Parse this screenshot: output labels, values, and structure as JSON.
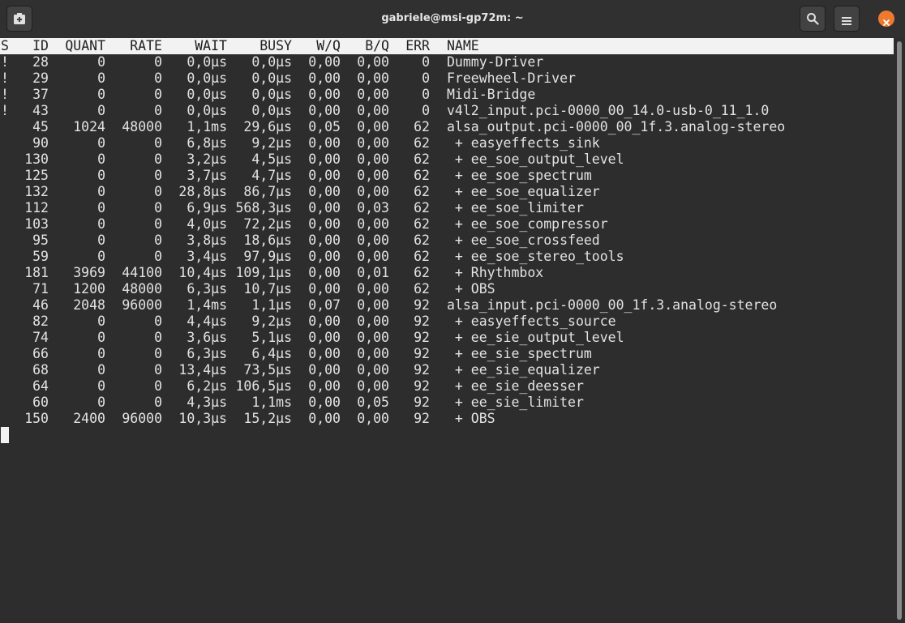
{
  "window": {
    "title": "gabriele@msi-gp72m: ~"
  },
  "icons": {
    "new_tab": "new-tab-icon",
    "search": "search-icon",
    "menu": "hamburger-menu-icon",
    "close": "close-icon"
  },
  "colors": {
    "close": "#ef7a2f",
    "background": "#2d2d2d",
    "header": "#f2f2f2"
  },
  "table": {
    "headers": [
      "S",
      "ID",
      "QUANT",
      "RATE",
      "WAIT",
      "BUSY",
      "W/Q",
      "B/Q",
      "ERR",
      "NAME"
    ],
    "rows": [
      [
        "!",
        "28",
        "0",
        "0",
        "0,0µs",
        "0,0µs",
        "0,00",
        "0,00",
        "0",
        "Dummy-Driver"
      ],
      [
        "!",
        "29",
        "0",
        "0",
        "0,0µs",
        "0,0µs",
        "0,00",
        "0,00",
        "0",
        "Freewheel-Driver"
      ],
      [
        "!",
        "37",
        "0",
        "0",
        "0,0µs",
        "0,0µs",
        "0,00",
        "0,00",
        "0",
        "Midi-Bridge"
      ],
      [
        "!",
        "43",
        "0",
        "0",
        "0,0µs",
        "0,0µs",
        "0,00",
        "0,00",
        "0",
        "v4l2_input.pci-0000_00_14.0-usb-0_11_1.0"
      ],
      [
        "",
        "45",
        "1024",
        "48000",
        "1,1ms",
        "29,6µs",
        "0,05",
        "0,00",
        "62",
        "alsa_output.pci-0000_00_1f.3.analog-stereo"
      ],
      [
        "",
        "90",
        "0",
        "0",
        "6,8µs",
        "9,2µs",
        "0,00",
        "0,00",
        "62",
        " + easyeffects_sink"
      ],
      [
        "",
        "130",
        "0",
        "0",
        "3,2µs",
        "4,5µs",
        "0,00",
        "0,00",
        "62",
        " + ee_soe_output_level"
      ],
      [
        "",
        "125",
        "0",
        "0",
        "3,7µs",
        "4,7µs",
        "0,00",
        "0,00",
        "62",
        " + ee_soe_spectrum"
      ],
      [
        "",
        "132",
        "0",
        "0",
        "28,8µs",
        "86,7µs",
        "0,00",
        "0,00",
        "62",
        " + ee_soe_equalizer"
      ],
      [
        "",
        "112",
        "0",
        "0",
        "6,9µs",
        "568,3µs",
        "0,00",
        "0,03",
        "62",
        " + ee_soe_limiter"
      ],
      [
        "",
        "103",
        "0",
        "0",
        "4,0µs",
        "72,2µs",
        "0,00",
        "0,00",
        "62",
        " + ee_soe_compressor"
      ],
      [
        "",
        "95",
        "0",
        "0",
        "3,8µs",
        "18,6µs",
        "0,00",
        "0,00",
        "62",
        " + ee_soe_crossfeed"
      ],
      [
        "",
        "59",
        "0",
        "0",
        "3,4µs",
        "97,9µs",
        "0,00",
        "0,00",
        "62",
        " + ee_soe_stereo_tools"
      ],
      [
        "",
        "181",
        "3969",
        "44100",
        "10,4µs",
        "109,1µs",
        "0,00",
        "0,01",
        "62",
        " + Rhythmbox"
      ],
      [
        "",
        "71",
        "1200",
        "48000",
        "6,3µs",
        "10,7µs",
        "0,00",
        "0,00",
        "62",
        " + OBS"
      ],
      [
        "",
        "46",
        "2048",
        "96000",
        "1,4ms",
        "1,1µs",
        "0,07",
        "0,00",
        "92",
        "alsa_input.pci-0000_00_1f.3.analog-stereo"
      ],
      [
        "",
        "82",
        "0",
        "0",
        "4,4µs",
        "9,2µs",
        "0,00",
        "0,00",
        "92",
        " + easyeffects_source"
      ],
      [
        "",
        "74",
        "0",
        "0",
        "3,6µs",
        "5,1µs",
        "0,00",
        "0,00",
        "92",
        " + ee_sie_output_level"
      ],
      [
        "",
        "66",
        "0",
        "0",
        "6,3µs",
        "6,4µs",
        "0,00",
        "0,00",
        "92",
        " + ee_sie_spectrum"
      ],
      [
        "",
        "68",
        "0",
        "0",
        "13,4µs",
        "73,5µs",
        "0,00",
        "0,00",
        "92",
        " + ee_sie_equalizer"
      ],
      [
        "",
        "64",
        "0",
        "0",
        "6,2µs",
        "106,5µs",
        "0,00",
        "0,00",
        "92",
        " + ee_sie_deesser"
      ],
      [
        "",
        "60",
        "0",
        "0",
        "4,3µs",
        "1,1ms",
        "0,00",
        "0,05",
        "92",
        " + ee_sie_limiter"
      ],
      [
        "",
        "150",
        "2400",
        "96000",
        "10,3µs",
        "15,2µs",
        "0,00",
        "0,00",
        "92",
        " + OBS"
      ]
    ]
  }
}
